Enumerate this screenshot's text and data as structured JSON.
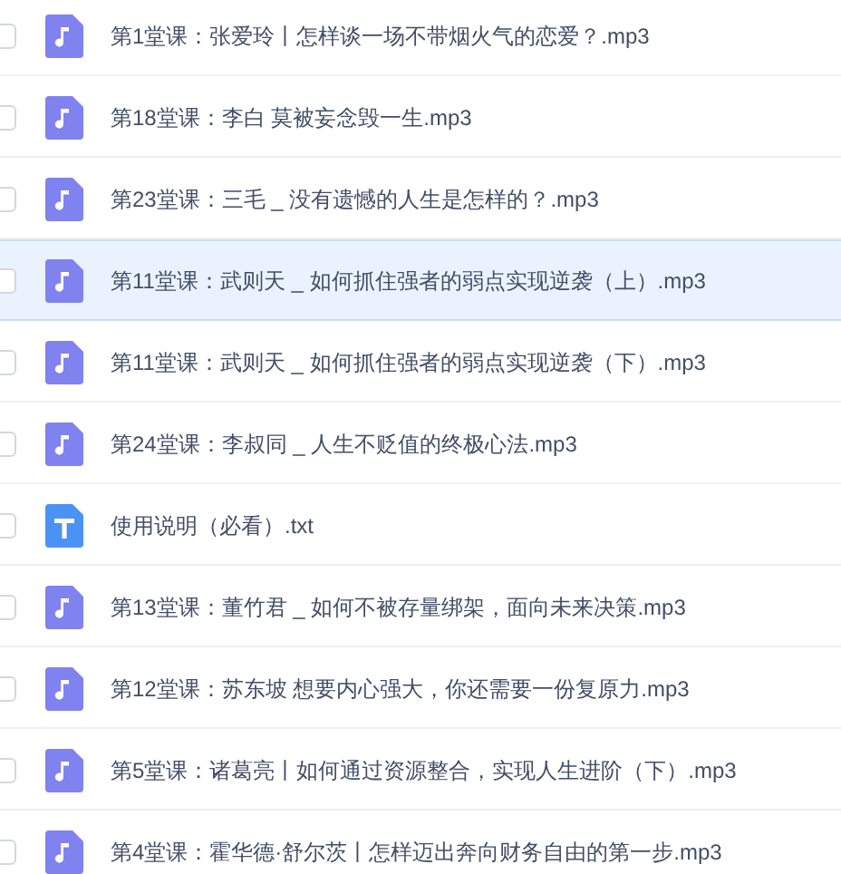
{
  "files": [
    {
      "name": "第1堂课：张爱玲丨怎样谈一场不带烟火气的恋爱？.mp3",
      "kind": "audio",
      "selected": false,
      "checked": false
    },
    {
      "name": "第18堂课：李白 莫被妄念毁一生.mp3",
      "kind": "audio",
      "selected": false,
      "checked": false
    },
    {
      "name": "第23堂课：三毛 _ 没有遗憾的人生是怎样的？.mp3",
      "kind": "audio",
      "selected": false,
      "checked": false
    },
    {
      "name": "第11堂课：武则天 _ 如何抓住强者的弱点实现逆袭（上）.mp3",
      "kind": "audio",
      "selected": true,
      "checked": false
    },
    {
      "name": "第11堂课：武则天 _ 如何抓住强者的弱点实现逆袭（下）.mp3",
      "kind": "audio",
      "selected": false,
      "checked": false
    },
    {
      "name": "第24堂课：李叔同 _ 人生不贬值的终极心法.mp3",
      "kind": "audio",
      "selected": false,
      "checked": false
    },
    {
      "name": "使用说明（必看）.txt",
      "kind": "text",
      "selected": false,
      "checked": false
    },
    {
      "name": "第13堂课：董竹君 _ 如何不被存量绑架，面向未来决策.mp3",
      "kind": "audio",
      "selected": false,
      "checked": false
    },
    {
      "name": "第12堂课：苏东坡 想要内心强大，你还需要一份复原力.mp3",
      "kind": "audio",
      "selected": false,
      "checked": false
    },
    {
      "name": "第5堂课：诸葛亮丨如何通过资源整合，实现人生进阶（下）.mp3",
      "kind": "audio",
      "selected": false,
      "checked": false
    },
    {
      "name": "第4堂课：霍华德·舒尔茨丨怎样迈出奔向财务自由的第一步.mp3",
      "kind": "audio",
      "selected": false,
      "checked": false
    }
  ]
}
